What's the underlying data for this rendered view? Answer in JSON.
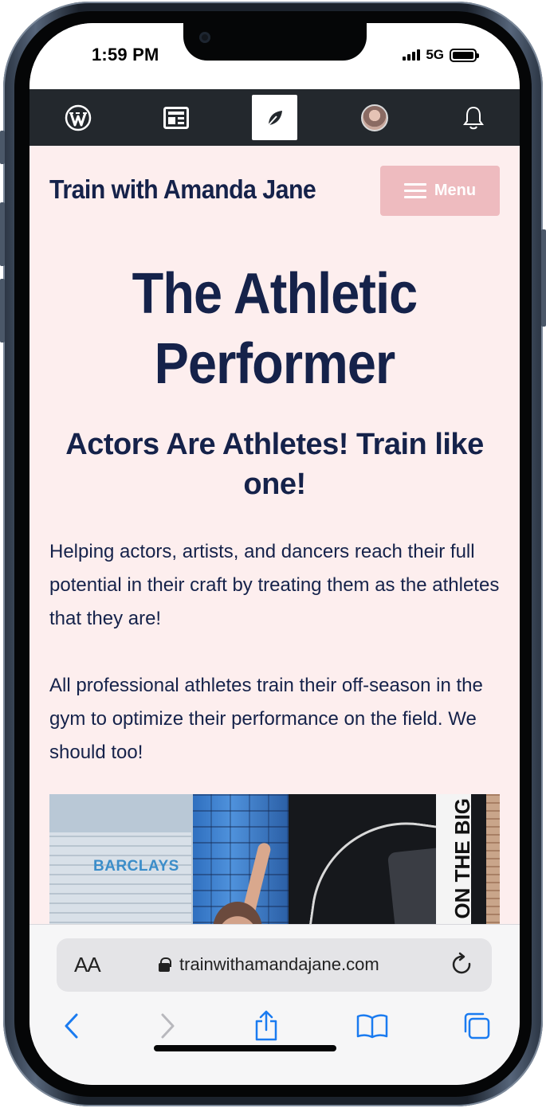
{
  "status_bar": {
    "time": "1:59 PM",
    "network": "5G",
    "icons": [
      "signal-icon",
      "battery-icon"
    ]
  },
  "wp_admin_bar": {
    "items": [
      {
        "icon": "wordpress-logo-icon"
      },
      {
        "icon": "reader-icon"
      },
      {
        "icon": "leaf-icon",
        "active": true
      },
      {
        "icon": "user-avatar-icon"
      },
      {
        "icon": "bell-icon"
      }
    ]
  },
  "site": {
    "title": "Train with Amanda Jane",
    "menu_label": "Menu",
    "accent_color": "#eebbbf",
    "background_color": "#fdeeee",
    "text_color": "#15224a"
  },
  "hero": {
    "title_line1": "The Athletic",
    "title_line2": "Performer",
    "subtitle": "Actors Are Athletes! Train like one!"
  },
  "body": {
    "paragraph1": "Helping actors, artists, and dancers reach their full potential in their craft by treating them as the athletes that they are!",
    "paragraph2": "All professional athletes train their off-season in the gym to optimize their performance on the field. We should too!"
  },
  "photo": {
    "sign_text": "BARCLAYS",
    "banner_text": "ED ON THE BIG"
  },
  "browser": {
    "text_size_label": "AA",
    "url": "trainwithamandajane.com",
    "toolbar": [
      "back-icon",
      "forward-icon",
      "share-icon",
      "bookmarks-icon",
      "tabs-icon"
    ]
  }
}
